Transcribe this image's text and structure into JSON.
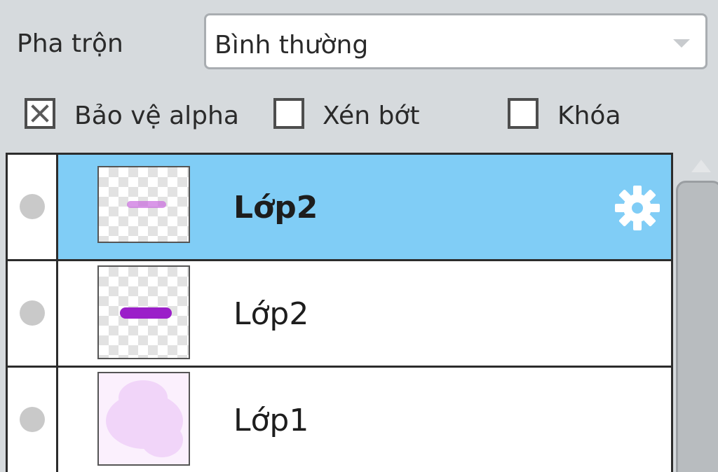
{
  "blend": {
    "label": "Pha trộn",
    "value": "Bình thường"
  },
  "options": {
    "protect_alpha": {
      "label": "Bảo vệ alpha",
      "checked": true
    },
    "clip": {
      "label": "Xén bớt",
      "checked": false
    },
    "lock": {
      "label": "Khóa",
      "checked": false
    }
  },
  "layers": [
    {
      "name": "Lớp2",
      "selected": true,
      "thumbnail": "light-purple-text"
    },
    {
      "name": "Lớp2",
      "selected": false,
      "thumbnail": "dark-purple-text"
    },
    {
      "name": "Lớp1",
      "selected": false,
      "thumbnail": "pink-cloud"
    }
  ],
  "colors": {
    "selected_row": "#80cdf6",
    "panel_bg": "#d6dadd"
  },
  "icons": {
    "settings": "gear-icon",
    "visibility": "visibility-dot-icon"
  }
}
